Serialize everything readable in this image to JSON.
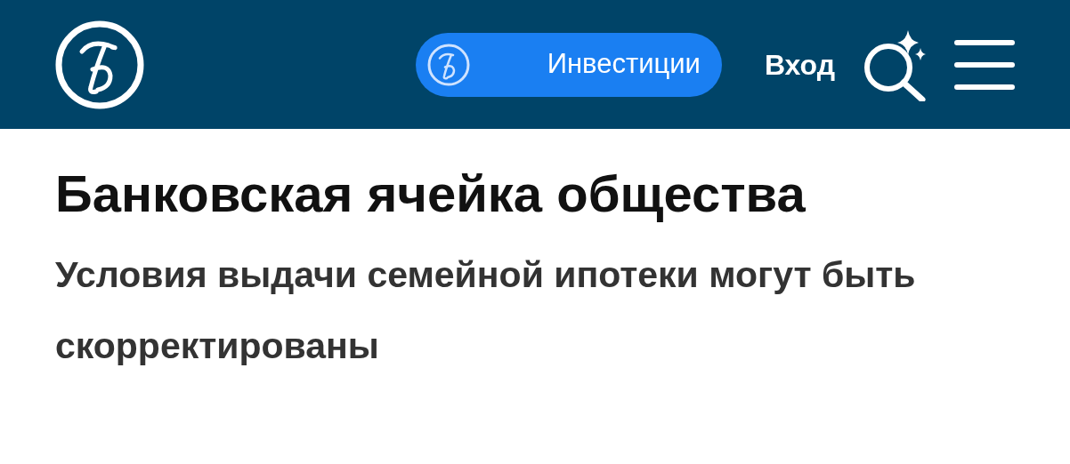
{
  "header": {
    "invest_button": "Инвестиции",
    "login": "Вход"
  },
  "article": {
    "title": "Банковская ячейка общества",
    "subtitle": "Условия выдачи семейной ипотеки могут быть скорректированы"
  }
}
